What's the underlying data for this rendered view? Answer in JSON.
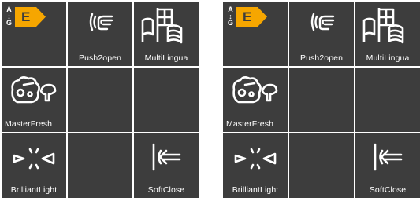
{
  "panels": [
    {
      "energy": {
        "scale_top": "A",
        "scale_bottom": "G",
        "class": "E",
        "badge_color": "#f6a600"
      },
      "features": {
        "push2open": "Push2open",
        "multilingua": "MultiLingua",
        "masterfresh": "MasterFresh",
        "brilliantlight": "BrilliantLight",
        "softclose": "SoftClose"
      }
    },
    {
      "energy": {
        "scale_top": "A",
        "scale_bottom": "G",
        "class": "E",
        "badge_color": "#f6a600"
      },
      "features": {
        "push2open": "Push2open",
        "multilingua": "MultiLingua",
        "masterfresh": "MasterFresh",
        "brilliantlight": "BrilliantLight",
        "softclose": "SoftClose"
      }
    }
  ],
  "icons": {
    "push2open": "push-hand-icon",
    "multilingua": "flags-icon",
    "masterfresh": "vegetables-cheese-icon",
    "brilliantlight": "light-beam-icon",
    "softclose": "soft-close-arrow-icon"
  },
  "colors": {
    "tile_bg": "#3d3d3d",
    "text": "#ffffff",
    "energy_badge": "#f6a600"
  }
}
